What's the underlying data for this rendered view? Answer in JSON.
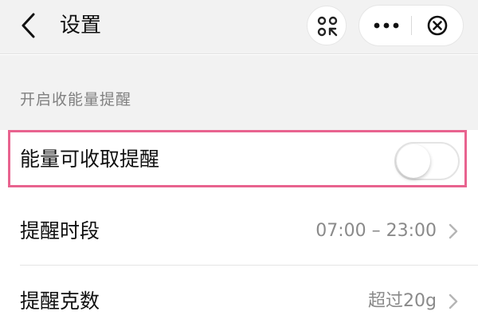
{
  "nav": {
    "title": "设置"
  },
  "section": {
    "header": "开启收能量提醒"
  },
  "rows": {
    "reminder": {
      "label": "能量可收取提醒",
      "toggle_on": false
    },
    "time_period": {
      "label": "提醒时段",
      "value": "07:00 – 23:00"
    },
    "grams": {
      "label": "提醒克数",
      "value": "超过20g"
    }
  },
  "colors": {
    "nav_bg": "#f2f2f2",
    "highlight": "#e8638f",
    "secondary_text": "#8a8a8a"
  },
  "icons": {
    "back": "chevron-left-icon",
    "scan": "scan-icon",
    "more": "more-dots-icon",
    "close": "close-circle-icon",
    "row_arrow": "chevron-right-icon"
  }
}
